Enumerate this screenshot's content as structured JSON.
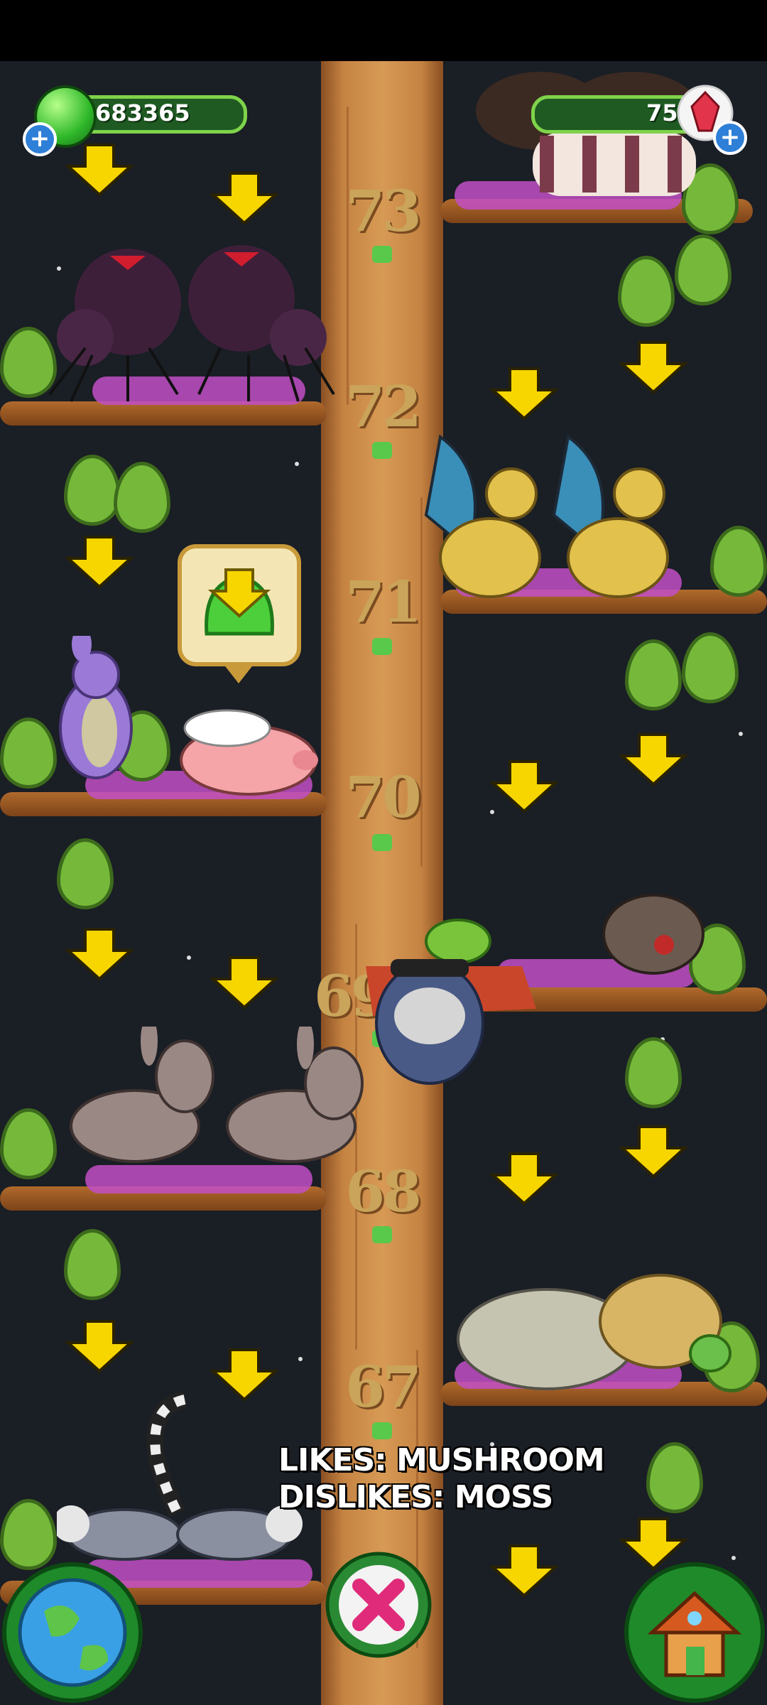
{
  "hud": {
    "jelly_count": "683365",
    "crystal_count": "75"
  },
  "tree": {
    "levels": [
      "73",
      "72",
      "71",
      "70",
      "69",
      "68",
      "67"
    ]
  },
  "tooltip": {
    "likes": "LIKES: MUSHROOM",
    "dislikes": "DISLIKES: MOSS"
  },
  "icons": {
    "jelly": "green-jelly-icon",
    "crystal": "red-crystal-icon",
    "add": "plus-icon",
    "arrow": "down-arrow-icon",
    "map": "globe-icon",
    "close": "close-icon",
    "home": "house-icon"
  },
  "colors": {
    "trunk": "#c58342",
    "arrow": "#f7d600",
    "leaf": "#76b93a",
    "nest": "#c24fc6",
    "hud_bar": "#1f5a22"
  }
}
